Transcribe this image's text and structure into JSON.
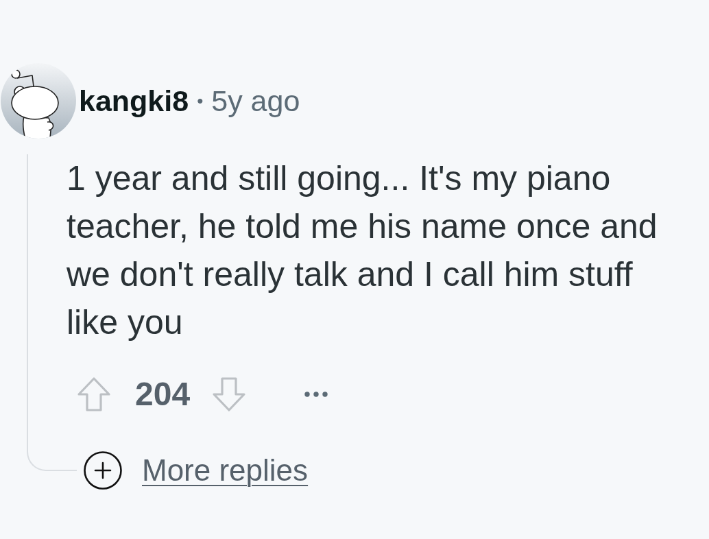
{
  "comment": {
    "author": "kangki8",
    "separator": "•",
    "time": "5y ago",
    "body": "1 year and still going... It's my piano teacher, he told me his name once and we don't really talk and I call him stuff like you",
    "score": "204",
    "more_replies": {
      "label": "More replies"
    }
  }
}
